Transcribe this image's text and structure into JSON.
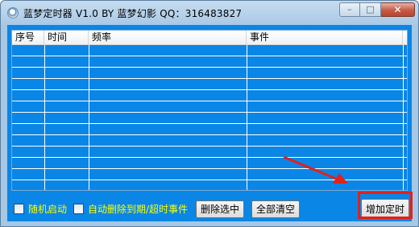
{
  "window": {
    "title": "蓝梦定时器 V1.0 BY 蓝梦幻影 QQ：316483827",
    "controls": {
      "minimize": "–",
      "maximize": "□",
      "close": "✕"
    }
  },
  "list": {
    "columns": [
      "序号",
      "时间",
      "频率",
      "事件"
    ],
    "rows": []
  },
  "options": {
    "autostart_label": "随机启动",
    "autostart_checked": false,
    "auto_delete_label": "自动删除到期/超时事件",
    "auto_delete_checked": false
  },
  "buttons": {
    "delete_selected": "删除选中",
    "clear_all": "全部清空",
    "add_timer": "增加定时"
  },
  "annotation": {
    "color": "#e3201b"
  },
  "colors": {
    "list_background": "#0a86e6",
    "option_text": "#ffff00"
  }
}
